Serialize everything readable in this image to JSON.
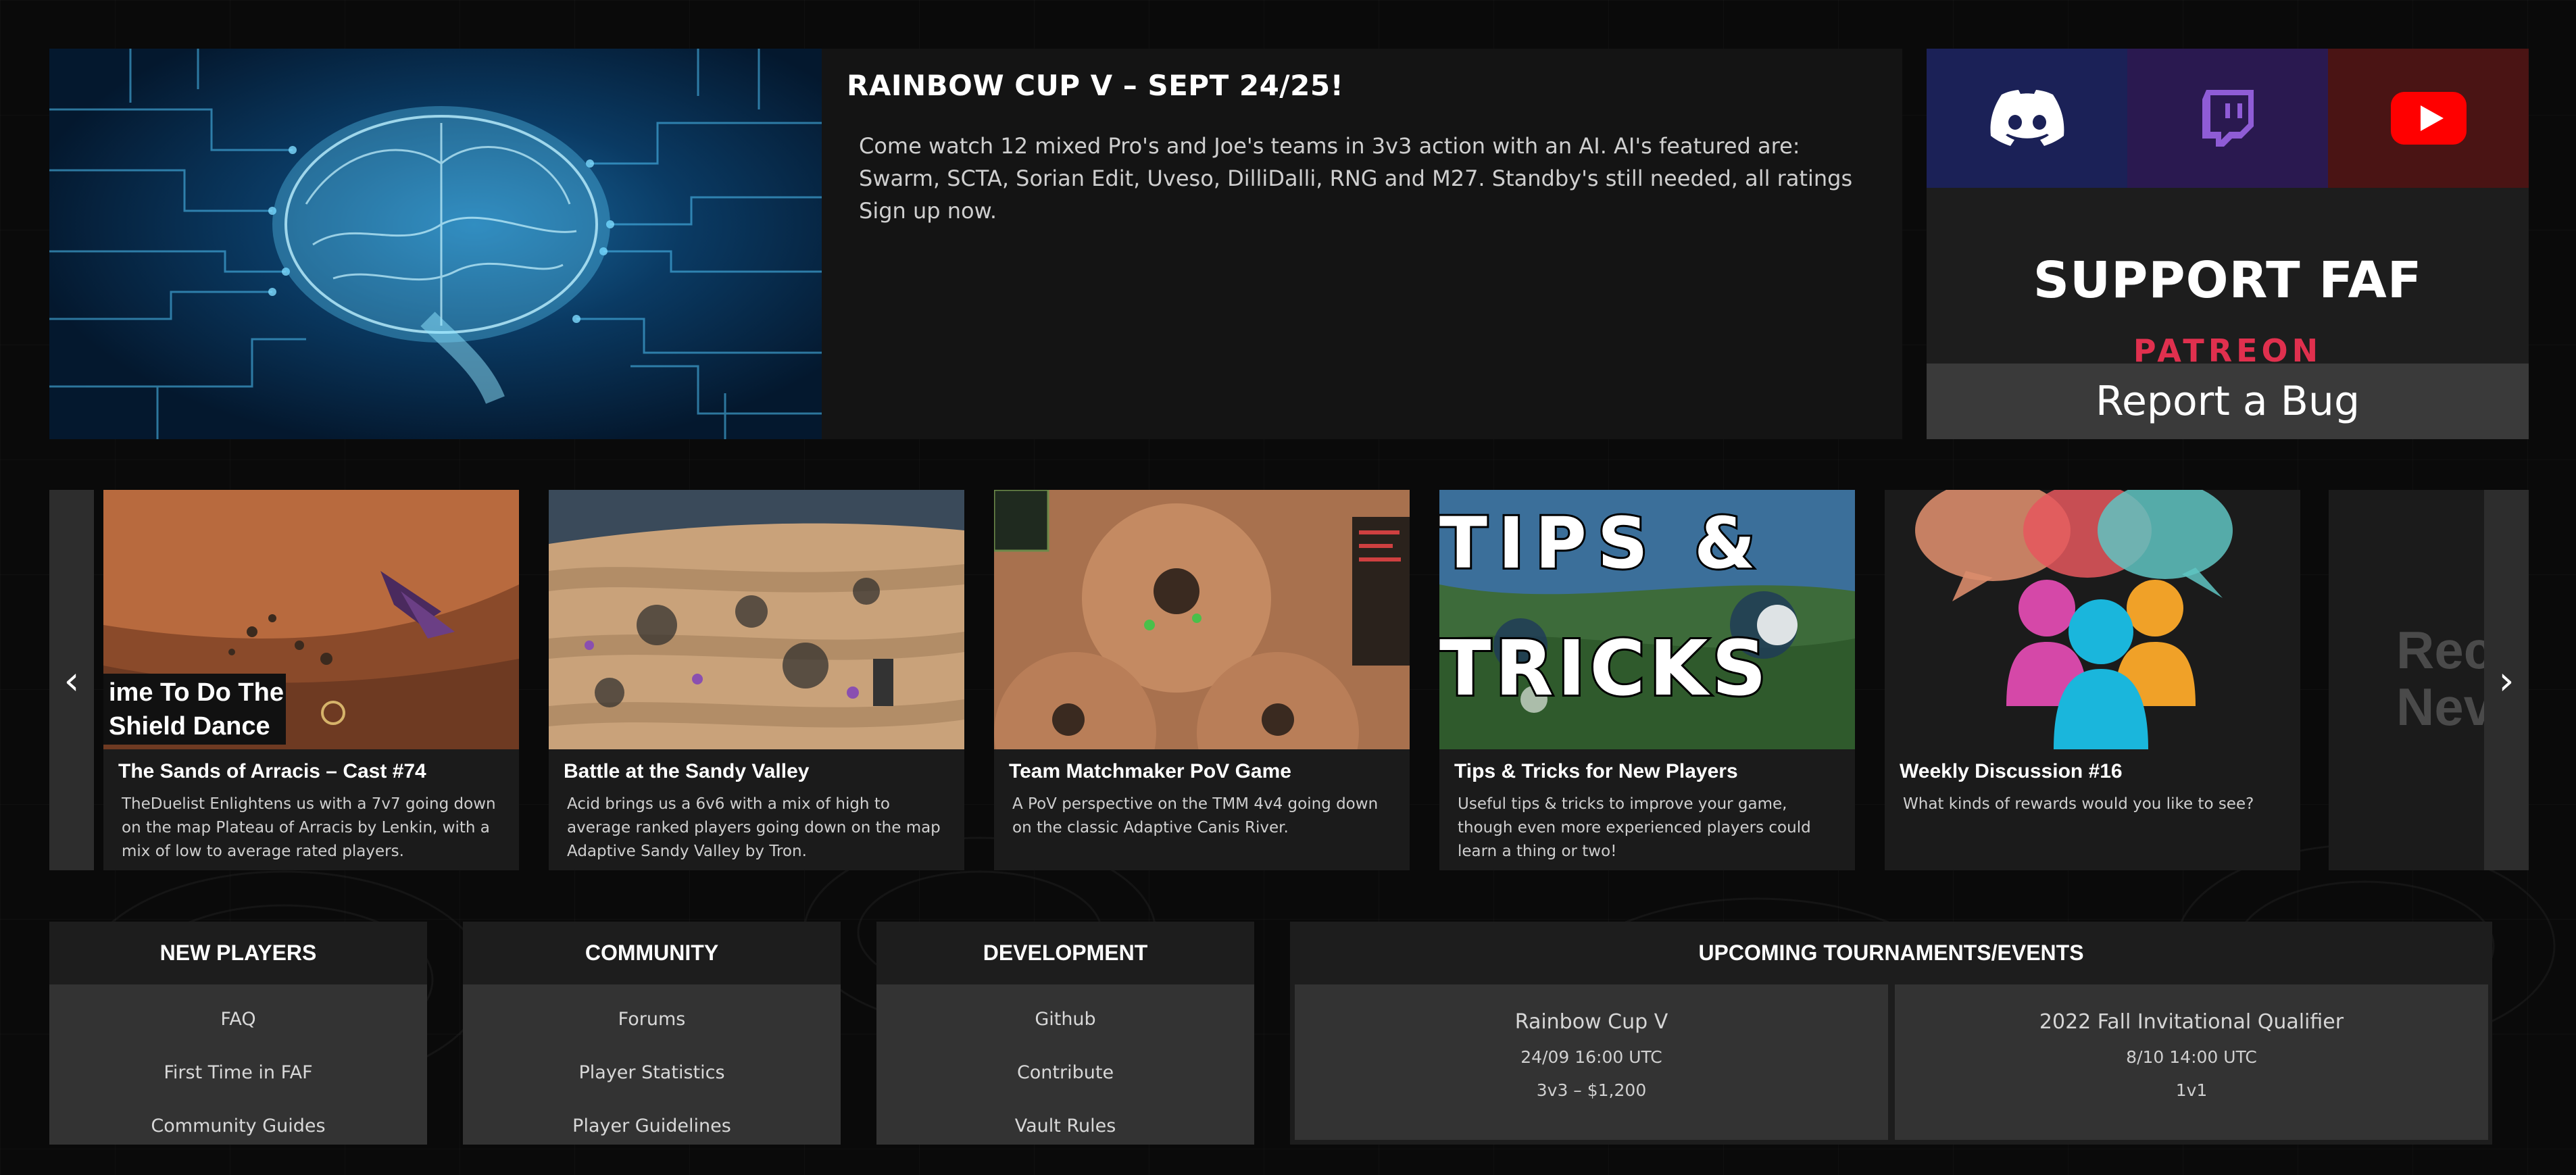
{
  "hero": {
    "title": "RAINBOW CUP V – SEPT 24/25!",
    "description": "Come watch 12 mixed Pro's and Joe's teams in 3v3 action with an AI. AI's featured are: Swarm, SCTA, Sorian Edit, Uveso, DilliDalli, RNG and M27. Standby's still needed, all ratings Sign up now.",
    "image_icon": "brain-circuit-image"
  },
  "support": {
    "social": [
      {
        "name": "discord",
        "icon": "discord-icon",
        "color": "#1b2157"
      },
      {
        "name": "twitch",
        "icon": "twitch-icon",
        "color": "#2a1950"
      },
      {
        "name": "youtube",
        "icon": "youtube-icon",
        "color": "#4a1414"
      }
    ],
    "title": "SUPPORT FAF",
    "patreon": "PATREON",
    "report_bug": "Report a Bug"
  },
  "carousel": {
    "prev_icon": "‹",
    "next_icon": "›",
    "cards": [
      {
        "overlay_text": "ime To Do The\nShield Dance",
        "title": "The Sands of Arracis – Cast #74",
        "description": "TheDuelist Enlightens us with a 7v7 going down on the map Plateau of Arracis by Lenkin, with a mix of low to average rated players."
      },
      {
        "title": "Battle at the Sandy Valley",
        "description": "Acid brings us a 6v6 with a mix of high to average ranked players going down on the map Adaptive Sandy Valley by Tron."
      },
      {
        "title": "Team Matchmaker PoV Game",
        "description": "A PoV perspective on the TMM 4v4 going down on the classic Adaptive Canis River."
      },
      {
        "overlay_line1": "TIPS &",
        "overlay_line2": "TRICKS",
        "title": "Tips & Tricks for New Players",
        "description": "Useful tips & tricks to improve your game, though even more experienced players could learn a thing or two!"
      },
      {
        "title": "Weekly Discussion #16",
        "description": "What kinds of rewards would you like to see?"
      }
    ],
    "partial_card_text": "Rec\nNev"
  },
  "panels": {
    "new_players": {
      "title": "NEW PLAYERS",
      "links": [
        "FAQ",
        "First Time in FAF",
        "Community Guides"
      ]
    },
    "community": {
      "title": "COMMUNITY",
      "links": [
        "Forums",
        "Player Statistics",
        "Player Guidelines"
      ]
    },
    "development": {
      "title": "DEVELOPMENT",
      "links": [
        "Github",
        "Contribute",
        "Vault Rules"
      ]
    }
  },
  "events": {
    "title": "UPCOMING TOURNAMENTS/EVENTS",
    "items": [
      {
        "name": "Rainbow Cup V",
        "date": "24/09 16:00 UTC",
        "prize": "3v3 – $1,200"
      },
      {
        "name": "2022 Fall Invitational Qualifier",
        "date": "8/10 14:00 UTC",
        "prize": "1v1"
      }
    ]
  }
}
